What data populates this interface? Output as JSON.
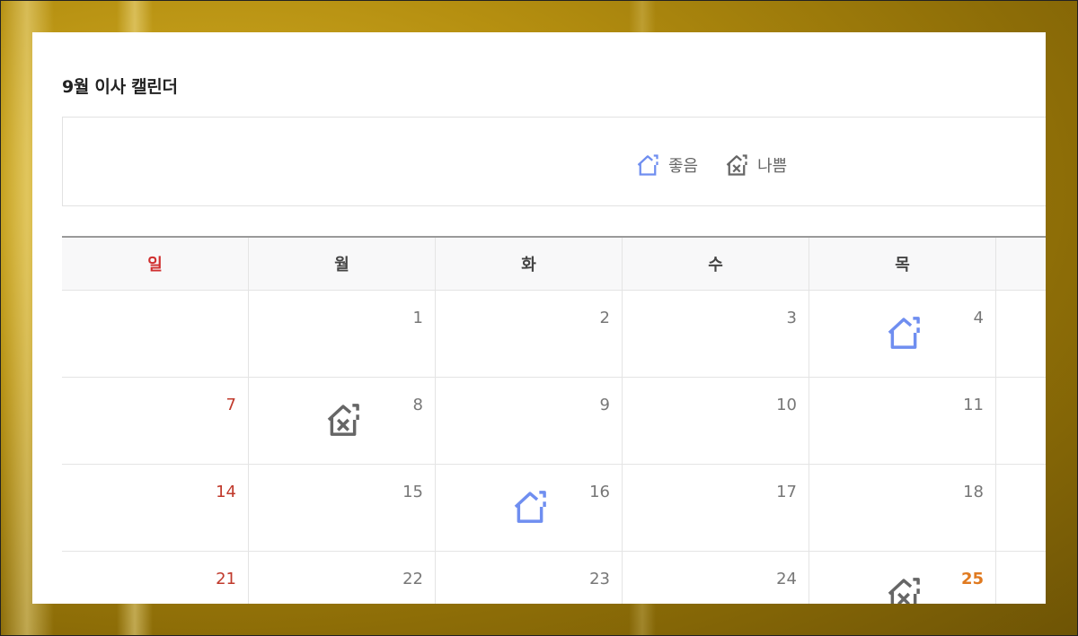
{
  "page": {
    "title": "9월 이사 캘린더"
  },
  "legend": {
    "good_label": "좋음",
    "bad_label": "나쁨",
    "good_icon": "house-good-icon",
    "bad_icon": "house-bad-icon"
  },
  "colors": {
    "good": "#6f8ef0",
    "bad": "#666666",
    "sunday": "#c0392b",
    "holiday": "#e07a20"
  },
  "calendar": {
    "weekdays": [
      "일",
      "월",
      "화",
      "수",
      "목"
    ],
    "weeks": [
      [
        {
          "day": ""
        },
        {
          "day": "1"
        },
        {
          "day": "2"
        },
        {
          "day": "3"
        },
        {
          "day": "4",
          "mark": "good"
        }
      ],
      [
        {
          "day": "7"
        },
        {
          "day": "8",
          "mark": "bad"
        },
        {
          "day": "9"
        },
        {
          "day": "10"
        },
        {
          "day": "11"
        }
      ],
      [
        {
          "day": "14"
        },
        {
          "day": "15"
        },
        {
          "day": "16",
          "mark": "good"
        },
        {
          "day": "17"
        },
        {
          "day": "18"
        }
      ],
      [
        {
          "day": "21"
        },
        {
          "day": "22"
        },
        {
          "day": "23"
        },
        {
          "day": "24"
        },
        {
          "day": "25",
          "mark": "bad",
          "holiday": true
        }
      ]
    ]
  }
}
